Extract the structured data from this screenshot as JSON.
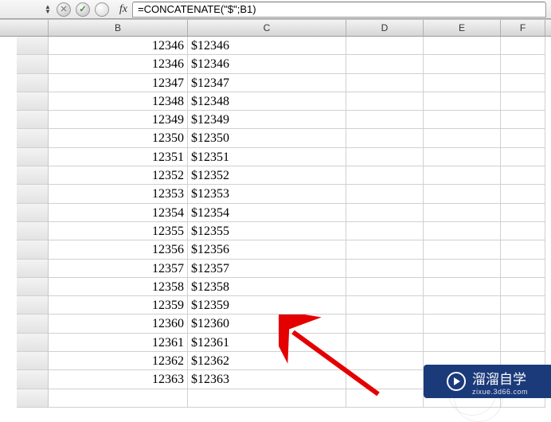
{
  "formula_bar": {
    "fx_label": "fx",
    "formula": "=CONCATENATE(\"$\";B1)"
  },
  "columns": [
    {
      "key": "B",
      "label": "B"
    },
    {
      "key": "C",
      "label": "C"
    },
    {
      "key": "D",
      "label": "D"
    },
    {
      "key": "E",
      "label": "E"
    },
    {
      "key": "F",
      "label": "F"
    }
  ],
  "rows": [
    {
      "B": "12346",
      "C": "$12346"
    },
    {
      "B": "12346",
      "C": "$12346"
    },
    {
      "B": "12347",
      "C": "$12347"
    },
    {
      "B": "12348",
      "C": "$12348"
    },
    {
      "B": "12349",
      "C": "$12349"
    },
    {
      "B": "12350",
      "C": "$12350"
    },
    {
      "B": "12351",
      "C": "$12351"
    },
    {
      "B": "12352",
      "C": "$12352"
    },
    {
      "B": "12353",
      "C": "$12353"
    },
    {
      "B": "12354",
      "C": "$12354"
    },
    {
      "B": "12355",
      "C": "$12355"
    },
    {
      "B": "12356",
      "C": "$12356"
    },
    {
      "B": "12357",
      "C": "$12357"
    },
    {
      "B": "12358",
      "C": "$12358"
    },
    {
      "B": "12359",
      "C": "$12359"
    },
    {
      "B": "12360",
      "C": "$12360"
    },
    {
      "B": "12361",
      "C": "$12361"
    },
    {
      "B": "12362",
      "C": "$12362"
    },
    {
      "B": "12363",
      "C": "$12363"
    },
    {
      "B": "",
      "C": ""
    }
  ],
  "watermark": {
    "brand": "溜溜自学",
    "url": "zixue.3d66.com"
  }
}
